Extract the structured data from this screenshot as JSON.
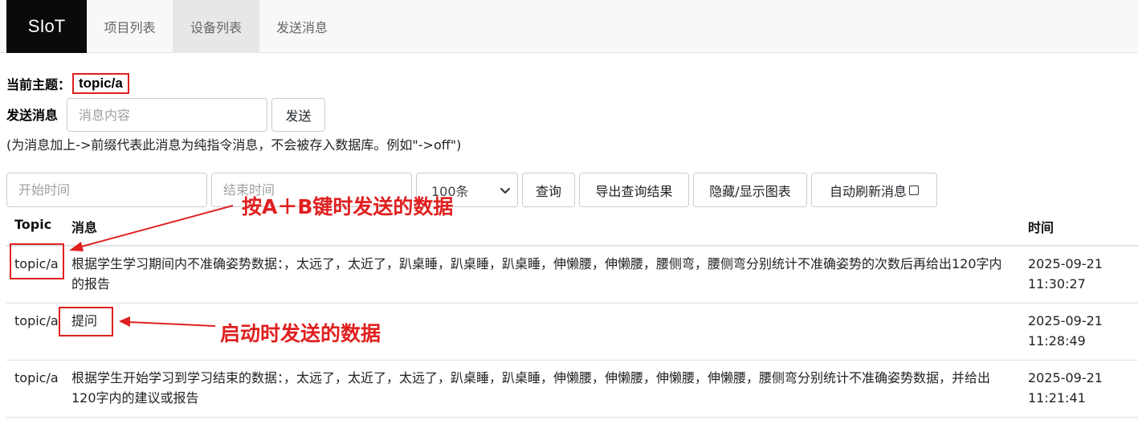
{
  "nav": {
    "brand": "SIoT",
    "items": [
      {
        "label": "项目列表",
        "active": false
      },
      {
        "label": "设备列表",
        "active": true
      },
      {
        "label": "发送消息",
        "active": false
      }
    ]
  },
  "topic": {
    "label": "当前主题：",
    "value": "topic/a"
  },
  "send": {
    "label": "发送消息",
    "placeholder": "消息内容",
    "button": "发送",
    "hint": "(为消息加上->前缀代表此消息为纯指令消息，不会被存入数据库。例如\"->off\")"
  },
  "query": {
    "start_placeholder": "开始时间",
    "end_placeholder": "结束时间",
    "limit_selected": "100条",
    "query_button": "查询",
    "export_button": "导出查询结果",
    "toggle_chart_button": "隐藏/显示图表",
    "auto_refresh_label": "自动刷新消息",
    "auto_refresh_checked": false
  },
  "table": {
    "headers": {
      "topic": "Topic",
      "message": "消息",
      "time": "时间"
    },
    "rows": [
      {
        "topic": "topic/a",
        "message": "根据学生学习期间内不准确姿势数据：，太远了，太近了，趴桌睡，趴桌睡，趴桌睡，伸懒腰，伸懒腰，腰侧弯，腰侧弯分别统计不准确姿势的次数后再给出120字内的报告",
        "date": "2025-09-21",
        "clock": "11:30:27"
      },
      {
        "topic": "topic/a",
        "message": "提问",
        "date": "2025-09-21",
        "clock": "11:28:49"
      },
      {
        "topic": "topic/a",
        "message": "根据学生开始学习到学习结束的数据：，太远了，太近了，太远了，趴桌睡，趴桌睡，伸懒腰，伸懒腰，伸懒腰，伸懒腰，腰侧弯分别统计不准确姿势数据，并给出120字内的建议或报告",
        "date": "2025-09-21",
        "clock": "11:21:41"
      }
    ]
  },
  "annotations": {
    "ab_key": "按A＋B键时发送的数据",
    "startup": "启动时发送的数据",
    "color": "#e02020"
  },
  "icons": {
    "select_arrow": "chevron-down-icon",
    "checkbox": "checkbox-icon"
  }
}
